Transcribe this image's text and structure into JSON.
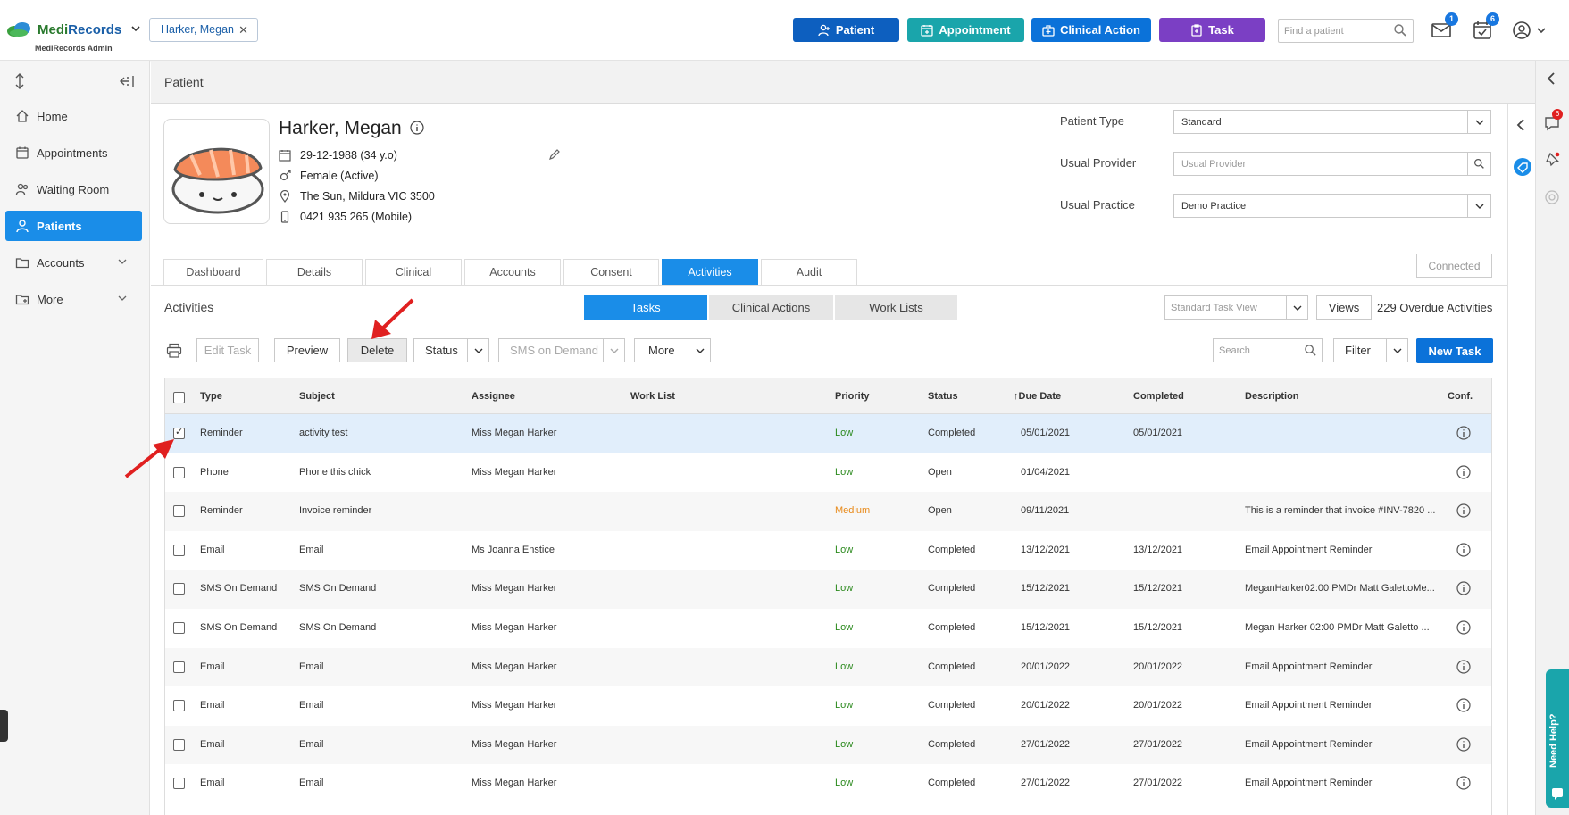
{
  "app": {
    "logo_name_a": "Medi",
    "logo_name_b": "Records",
    "logo_sub": "MediRecords Admin",
    "patient_chip": "Harker, Megan",
    "find_placeholder": "Find a patient",
    "mail_badge": "1",
    "tasks_badge": "6"
  },
  "top_buttons": {
    "patient": "Patient",
    "appointment": "Appointment",
    "clinical_action": "Clinical Action",
    "task": "Task"
  },
  "sidebar": {
    "items": [
      {
        "label": "Home",
        "icon": "home-icon"
      },
      {
        "label": "Appointments",
        "icon": "calendar-icon"
      },
      {
        "label": "Waiting Room",
        "icon": "people-icon"
      },
      {
        "label": "Patients",
        "icon": "user-icon"
      },
      {
        "label": "Accounts",
        "icon": "folder-icon"
      },
      {
        "label": "More",
        "icon": "folder-plus-icon"
      }
    ]
  },
  "page": {
    "title": "Patient",
    "patient_name": "Harker, Megan",
    "dob": "29-12-1988 (34 y.o)",
    "gender": "Female (Active)",
    "address": "The Sun, Mildura VIC 3500",
    "phone": "0421 935 265 (Mobile)"
  },
  "right_fields": {
    "patient_type_label": "Patient Type",
    "patient_type_value": "Standard",
    "usual_provider_label": "Usual Provider",
    "usual_provider_placeholder": "Usual Provider",
    "usual_practice_label": "Usual Practice",
    "usual_practice_value": "Demo Practice",
    "connected": "Connected"
  },
  "tabs": [
    "Dashboard",
    "Details",
    "Clinical",
    "Accounts",
    "Consent",
    "Activities",
    "Audit"
  ],
  "activities": {
    "title": "Activities",
    "segments": [
      "Tasks",
      "Clinical Actions",
      "Work Lists"
    ],
    "view_placeholder": "Standard Task View",
    "views_label": "Views",
    "overdue": "229 Overdue Activities"
  },
  "toolbar": {
    "edit_task": "Edit Task",
    "preview": "Preview",
    "delete": "Delete",
    "status": "Status",
    "sms_on_demand": "SMS on Demand",
    "more": "More",
    "search_placeholder": "Search",
    "filter": "Filter",
    "new_task": "New Task"
  },
  "table": {
    "headers": [
      "Type",
      "Subject",
      "Assignee",
      "Work List",
      "Priority",
      "Status",
      "Due Date",
      "Completed",
      "Description",
      "Conf."
    ],
    "rows": [
      {
        "type": "Reminder",
        "subject": "activity test",
        "assignee": "Miss Megan Harker",
        "work_list": "",
        "priority": "Low",
        "status": "Completed",
        "due": "05/01/2021",
        "completed": "05/01/2021",
        "description": "",
        "checked": true
      },
      {
        "type": "Phone",
        "subject": "Phone this chick",
        "assignee": "Miss Megan Harker",
        "work_list": "",
        "priority": "Low",
        "status": "Open",
        "due": "01/04/2021",
        "completed": "",
        "description": "",
        "checked": false
      },
      {
        "type": "Reminder",
        "subject": "Invoice reminder",
        "assignee": "",
        "work_list": "",
        "priority": "Medium",
        "status": "Open",
        "due": "09/11/2021",
        "completed": "",
        "description": "This is a reminder that invoice #INV-7820 ...",
        "checked": false
      },
      {
        "type": "Email",
        "subject": "Email",
        "assignee": "Ms Joanna Enstice",
        "work_list": "",
        "priority": "Low",
        "status": "Completed",
        "due": "13/12/2021",
        "completed": "13/12/2021",
        "description": "Email Appointment Reminder",
        "checked": false
      },
      {
        "type": "SMS On Demand",
        "subject": "SMS On Demand",
        "assignee": "Miss Megan Harker",
        "work_list": "",
        "priority": "Low",
        "status": "Completed",
        "due": "15/12/2021",
        "completed": "15/12/2021",
        "description": "MeganHarker02:00 PMDr Matt GalettoMe...",
        "checked": false
      },
      {
        "type": "SMS On Demand",
        "subject": "SMS On Demand",
        "assignee": "Miss Megan Harker",
        "work_list": "",
        "priority": "Low",
        "status": "Completed",
        "due": "15/12/2021",
        "completed": "15/12/2021",
        "description": "Megan Harker 02:00 PMDr Matt Galetto ...",
        "checked": false
      },
      {
        "type": "Email",
        "subject": "Email",
        "assignee": "Miss Megan Harker",
        "work_list": "",
        "priority": "Low",
        "status": "Completed",
        "due": "20/01/2022",
        "completed": "20/01/2022",
        "description": "Email Appointment Reminder",
        "checked": false
      },
      {
        "type": "Email",
        "subject": "Email",
        "assignee": "Miss Megan Harker",
        "work_list": "",
        "priority": "Low",
        "status": "Completed",
        "due": "20/01/2022",
        "completed": "20/01/2022",
        "description": "Email Appointment Reminder",
        "checked": false
      },
      {
        "type": "Email",
        "subject": "Email",
        "assignee": "Miss Megan Harker",
        "work_list": "",
        "priority": "Low",
        "status": "Completed",
        "due": "27/01/2022",
        "completed": "27/01/2022",
        "description": "Email Appointment Reminder",
        "checked": false
      },
      {
        "type": "Email",
        "subject": "Email",
        "assignee": "Miss Megan Harker",
        "work_list": "",
        "priority": "Low",
        "status": "Completed",
        "due": "27/01/2022",
        "completed": "27/01/2022",
        "description": "Email Appointment Reminder",
        "checked": false
      }
    ]
  },
  "help": {
    "label": "Need Help?",
    "chat_badge": "6"
  },
  "colors": {
    "primary": "#1a8de8",
    "patient_btn": "#0d5fbf",
    "appt_btn": "#1aa5ab",
    "clin_btn": "#0b72d9",
    "task_btn": "#7b3fc4",
    "arrow": "#e02020"
  }
}
